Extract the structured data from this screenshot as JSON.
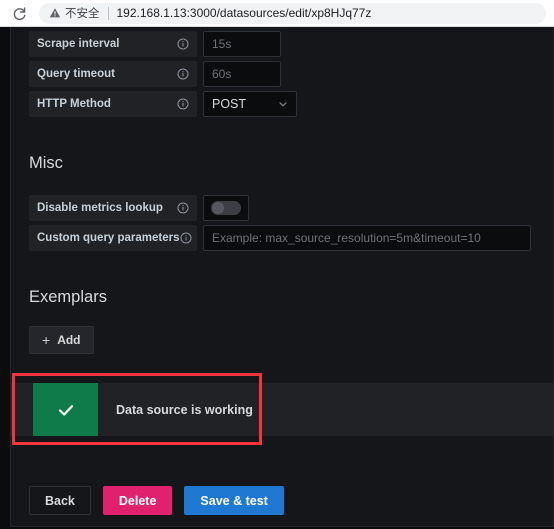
{
  "browser": {
    "reload_icon": "reload-icon",
    "warning_icon": "warning-triangle-icon",
    "security_label": "不安全",
    "url": "192.168.1.13:3000/datasources/edit/xp8HJq77z"
  },
  "form": {
    "rows": [
      {
        "label": "Scrape interval",
        "info_icon": "info-circle-icon",
        "value": "15s",
        "type": "text"
      },
      {
        "label": "Query timeout",
        "info_icon": "info-circle-icon",
        "value": "60s",
        "type": "text"
      },
      {
        "label": "HTTP Method",
        "info_icon": "info-circle-icon",
        "value": "POST",
        "type": "select",
        "caret_icon": "chevron-down-icon"
      }
    ]
  },
  "misc": {
    "title": "Misc",
    "disable_metrics_lookup": {
      "label": "Disable metrics lookup",
      "info_icon": "info-circle-icon",
      "enabled": false
    },
    "custom_query_parameters": {
      "label": "Custom query parameters",
      "info_icon": "info-circle-icon",
      "placeholder": "Example: max_source_resolution=5m&timeout=10"
    }
  },
  "exemplars": {
    "title": "Exemplars",
    "add_button": {
      "icon": "plus-icon",
      "label": "Add"
    }
  },
  "alert": {
    "icon": "check-icon",
    "message": "Data source is working",
    "icon_background": "#0f7a4a",
    "band_background": "#202226"
  },
  "annotation": {
    "color": "#f4333d"
  },
  "footer": {
    "back_label": "Back",
    "delete_label": "Delete",
    "save_label": "Save & test",
    "delete_color": "#e0226e",
    "save_color": "#1f78d1"
  }
}
